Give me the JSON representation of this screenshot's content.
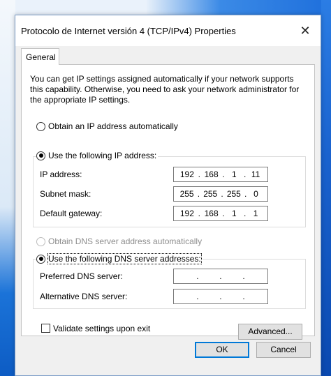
{
  "window": {
    "title": "Protocolo de Internet versión 4 (TCP/IPv4) Properties",
    "close_glyph": "✕"
  },
  "tabs": [
    {
      "label": "General"
    }
  ],
  "intro_text": "You can get IP settings assigned automatically if your network supports this capability. Otherwise, you need to ask your network administrator for the appropriate IP settings.",
  "ip_section": {
    "auto_option": {
      "label": "Obtain an IP address automatically",
      "selected": false
    },
    "manual_option": {
      "label": "Use the following IP address:",
      "selected": true
    },
    "fields": [
      {
        "label": "IP address:",
        "octets": [
          "192",
          "168",
          "1",
          "11"
        ]
      },
      {
        "label": "Subnet mask:",
        "octets": [
          "255",
          "255",
          "255",
          "0"
        ]
      },
      {
        "label": "Default gateway:",
        "octets": [
          "192",
          "168",
          "1",
          "1"
        ]
      }
    ]
  },
  "dns_section": {
    "auto_option": {
      "label": "Obtain DNS server address automatically",
      "selected": false,
      "disabled": true
    },
    "manual_option": {
      "label": "Use the following DNS server addresses:",
      "selected": true
    },
    "fields": [
      {
        "label": "Preferred DNS server:",
        "octets": [
          "",
          "",
          "",
          ""
        ]
      },
      {
        "label": "Alternative DNS server:",
        "octets": [
          "",
          "",
          "",
          ""
        ]
      }
    ]
  },
  "validate": {
    "label": "Validate settings upon exit",
    "checked": false
  },
  "buttons": {
    "advanced": "Advanced...",
    "ok": "OK",
    "cancel": "Cancel"
  }
}
